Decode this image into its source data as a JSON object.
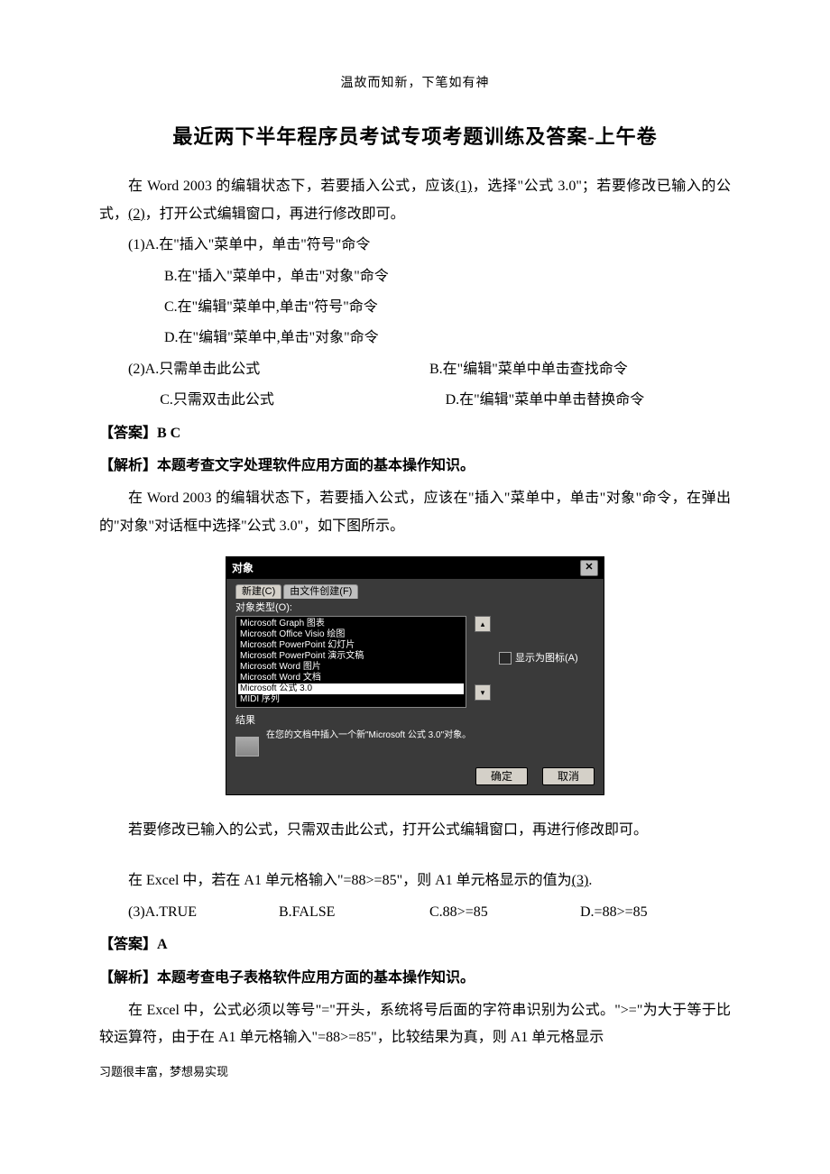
{
  "header_note": "温故而知新，下笔如有神",
  "title": "最近两下半年程序员考试专项考题训练及答案-上午卷",
  "p1_a": "在 Word 2003 的编辑状态下，若要插入公式，应该",
  "p1_blank1": "(1)",
  "p1_b": "，选择\"公式 3.0\"；若要修改已输入的公式，",
  "p1_blank2": "(2)",
  "p1_c": "，打开公式编辑窗口，再进行修改即可。",
  "q1_opts": {
    "a": "(1)A.在\"插入\"菜单中，单击\"符号\"命令",
    "b": "B.在\"插入\"菜单中，单击\"对象\"命令",
    "c": "C.在\"编辑\"菜单中,单击\"符号\"命令",
    "d": "D.在\"编辑\"菜单中,单击\"对象\"命令"
  },
  "q2_opts": {
    "a": "(2)A.只需单击此公式",
    "b": "B.在\"编辑\"菜单中单击查找命令",
    "c": "C.只需双击此公式",
    "d": "D.在\"编辑\"菜单中单击替换命令"
  },
  "ans1": "【答案】B   C",
  "ana1_head": "【解析】本题考查文字处理软件应用方面的基本操作知识。",
  "ana1_p1": "在 Word 2003 的编辑状态下，若要插入公式，应该在\"插入\"菜单中，单击\"对象\"命令，在弹出的\"对象\"对话框中选择\"公式 3.0\"，如下图所示。",
  "dialog": {
    "title": "对象",
    "tab1": "新建(C)",
    "tab2": "由文件创建(F)",
    "type_label": "对象类型(O):",
    "items": [
      "Microsoft Graph 图表",
      "Microsoft Office Visio 绘图",
      "Microsoft PowerPoint 幻灯片",
      "Microsoft PowerPoint 演示文稿",
      "Microsoft Word 图片",
      "Microsoft Word 文档",
      "Microsoft 公式 3.0",
      "MIDI 序列"
    ],
    "selected_index": 6,
    "show_as_icon": "显示为图标(A)",
    "result_label": "结果",
    "result_text": "在您的文档中插入一个新\"Microsoft 公式 3.0\"对象。",
    "ok": "确定",
    "cancel": "取消"
  },
  "ana1_p2": "若要修改已输入的公式，只需双击此公式，打开公式编辑窗口，再进行修改即可。",
  "p2_a": "在 Excel 中，若在 A1 单元格输入\"=88>=85\"，则 A1 单元格显示的值为",
  "p2_blank": "(3)",
  "p2_b": ".",
  "q3_opts": {
    "a": "(3)A.TRUE",
    "b": "B.FALSE",
    "c": "C.88>=85",
    "d": "D.=88>=85"
  },
  "ans2": "【答案】A",
  "ana2_head": "【解析】本题考查电子表格软件应用方面的基本操作知识。",
  "ana2_p1": "在 Excel 中，公式必须以等号\"=\"开头，系统将号后面的字符串识别为公式。\">=\"为大于等于比较运算符，由于在 A1 单元格输入\"=88>=85\"，比较结果为真，则 A1 单元格显示",
  "footer_note": "习题很丰富，梦想易实现"
}
